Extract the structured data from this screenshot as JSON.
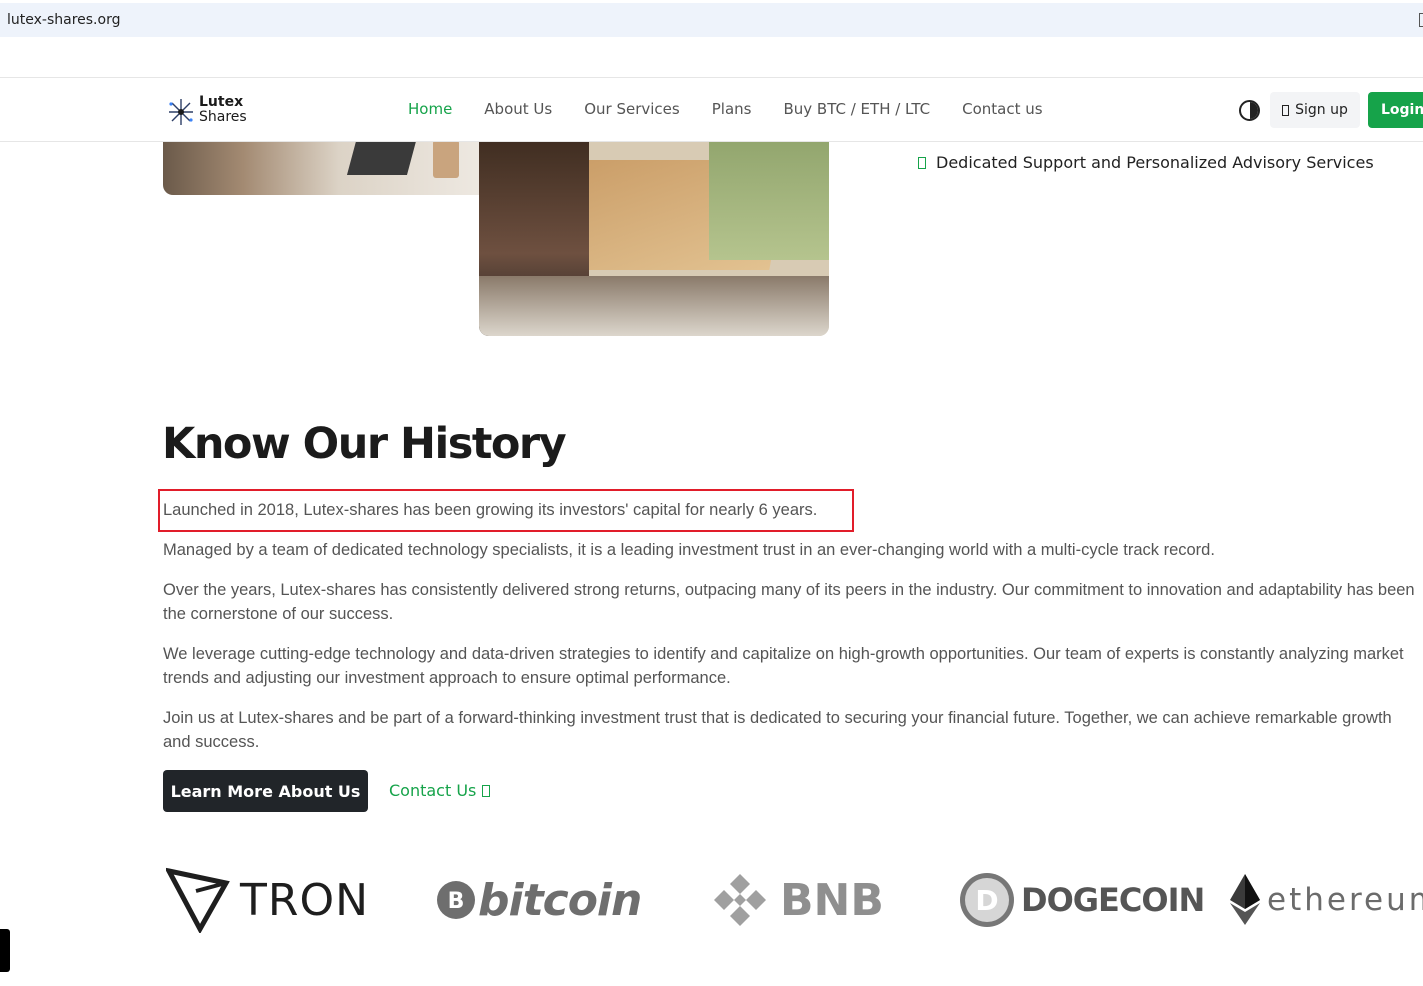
{
  "browser": {
    "url": "lutex-shares.org"
  },
  "navbar": {
    "logo_line1": "Lutex",
    "logo_line2": "Shares",
    "links": [
      "Home",
      "About Us",
      "Our Services",
      "Plans",
      "Buy BTC / ETH / LTC",
      "Contact us"
    ],
    "active_link": "Home",
    "signup_label": "Sign up",
    "login_label": "Login"
  },
  "features": {
    "item_visible": "Dedicated Support and Personalized Advisory Services"
  },
  "history": {
    "title": "Know Our History",
    "paragraphs": [
      "Launched in 2018, Lutex-shares has been growing its investors' capital for nearly 6 years.",
      "Managed by a team of dedicated technology specialists, it is a leading investment trust in an ever-changing world with a multi-cycle track record.",
      "Over the years, Lutex-shares has consistently delivered strong returns, outpacing many of its peers in the industry. Our commitment to innovation and adaptability has been the cornerstone of our success.",
      "We leverage cutting-edge technology and data-driven strategies to identify and capitalize on high-growth opportunities. Our team of experts is constantly analyzing market trends and adjusting our investment approach to ensure optimal performance.",
      "Join us at Lutex-shares and be part of a forward-thinking investment trust that is dedicated to securing your financial future. Together, we can achieve remarkable growth and success."
    ],
    "learn_more_label": "Learn More About Us",
    "contact_label": "Contact Us"
  },
  "coins": [
    {
      "name": "TRON",
      "icon": "tron-icon"
    },
    {
      "name": "bitcoin",
      "icon": "bitcoin-icon"
    },
    {
      "name": "BNB",
      "icon": "bnb-icon"
    },
    {
      "name": "DOGECOIN",
      "icon": "dogecoin-icon"
    },
    {
      "name": "ethereum",
      "icon": "ethereum-icon"
    }
  ],
  "colors": {
    "accent": "#16a34a",
    "dark": "#212529",
    "highlight": "#e11d2a"
  }
}
